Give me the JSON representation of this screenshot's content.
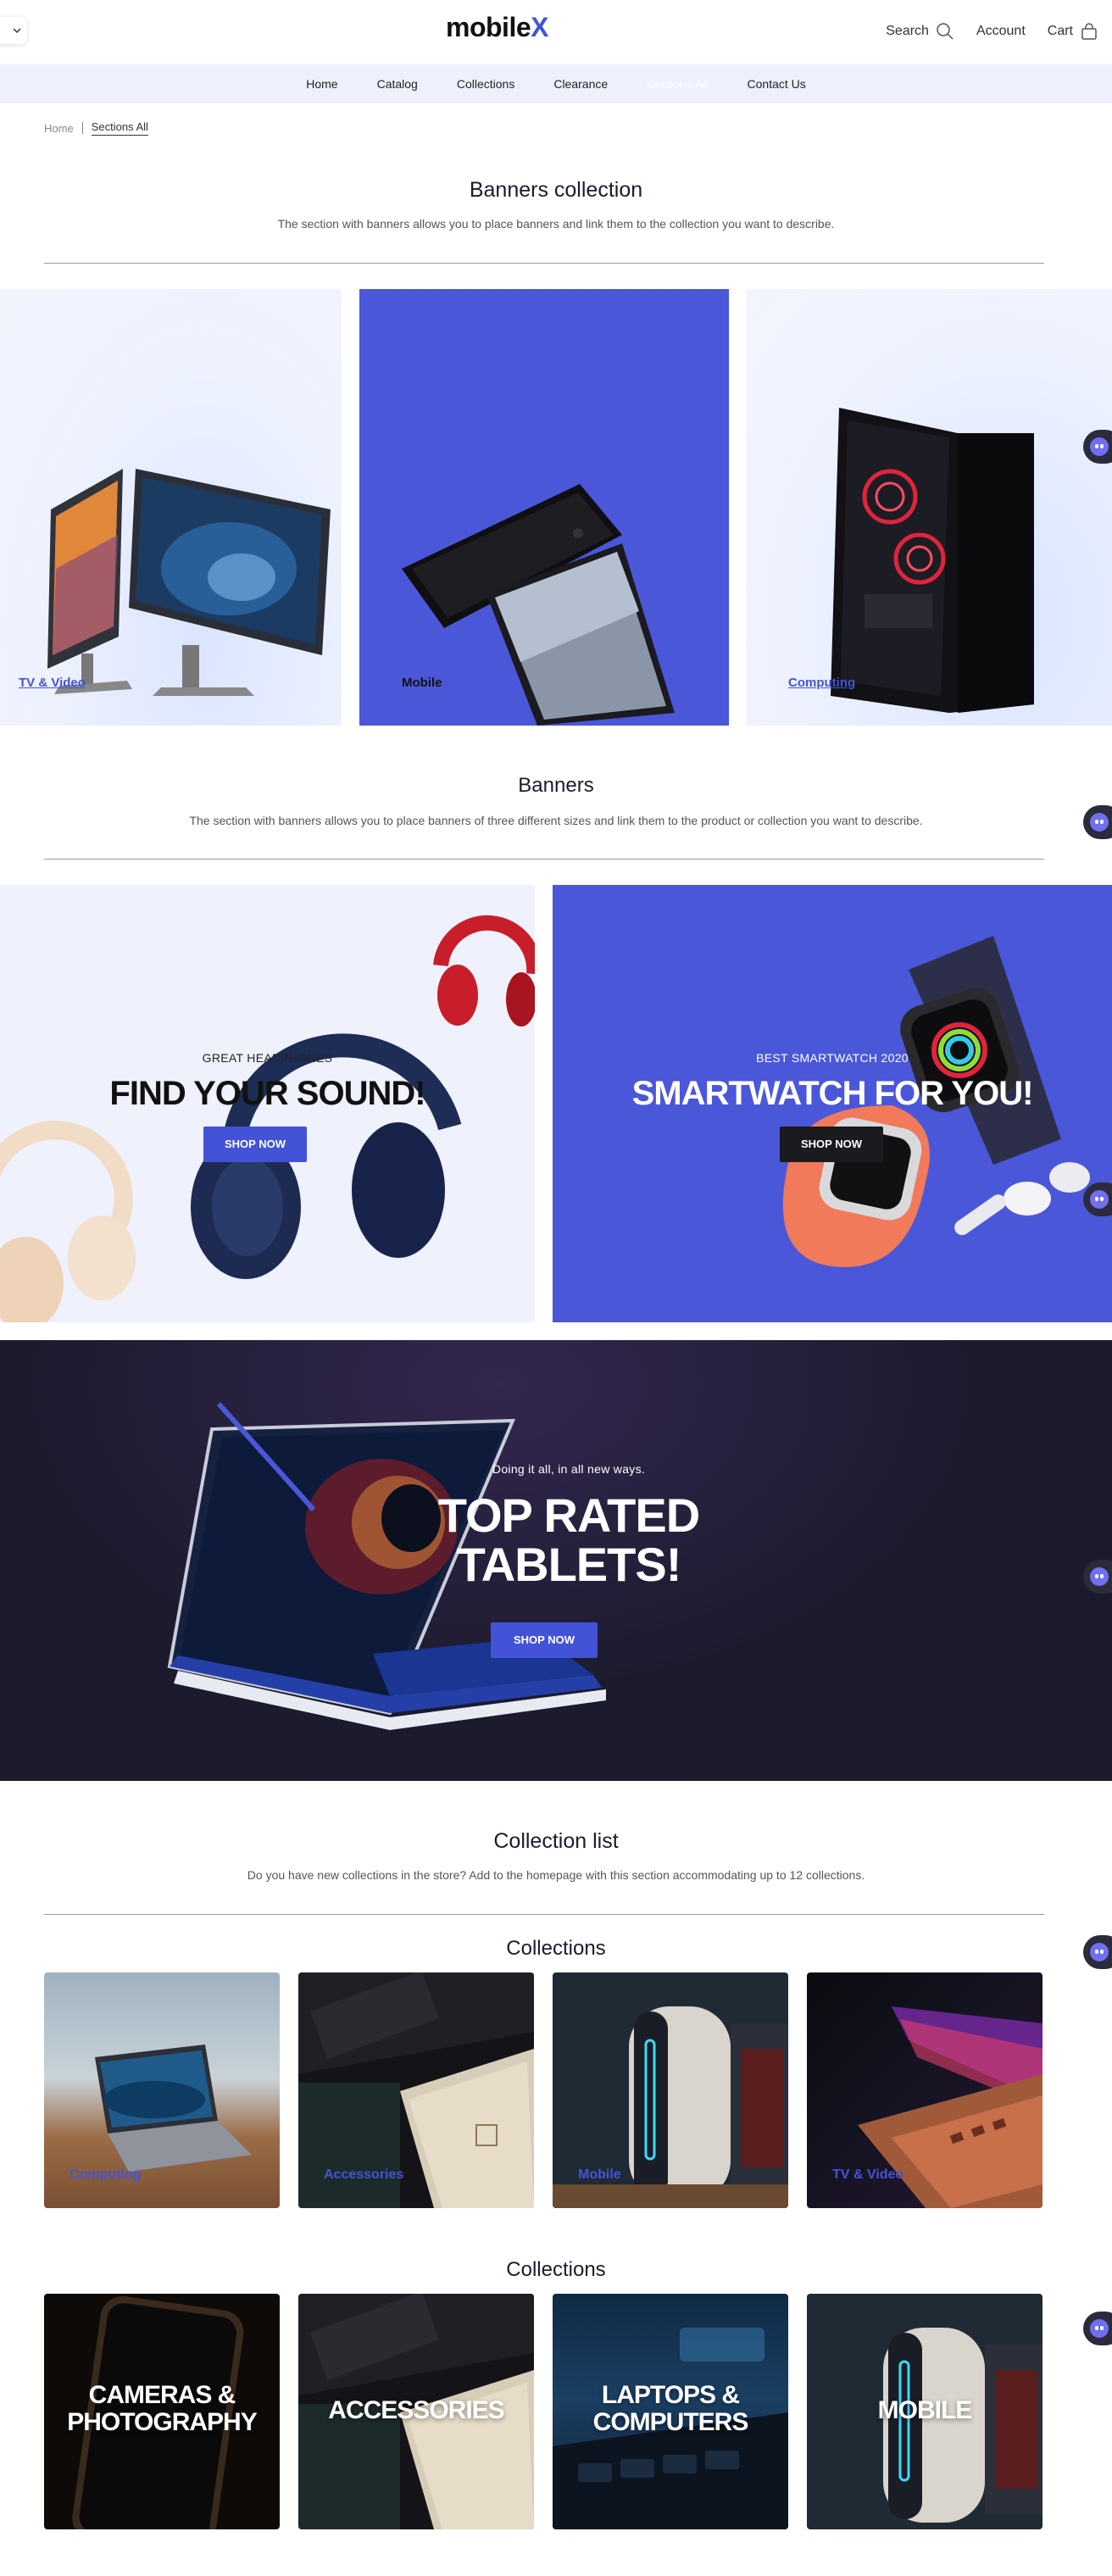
{
  "header": {
    "logo_main": "mobile",
    "logo_accent": "X",
    "search_label": "Search",
    "account_label": "Account",
    "cart_label": "Cart"
  },
  "nav": {
    "items": [
      "Home",
      "Catalog",
      "Collections",
      "Clearance",
      "Sections All",
      "Contact Us"
    ]
  },
  "breadcrumb": {
    "home": "Home",
    "current": "Sections All"
  },
  "banners_collection": {
    "title": "Banners collection",
    "description": "The section with banners allows you to place banners and link them to the collection you want to describe.",
    "items": [
      {
        "label": "TV & Video"
      },
      {
        "label": "Mobile"
      },
      {
        "label": "Computing"
      }
    ]
  },
  "banners": {
    "title": "Banners",
    "description": "The section with banners allows you to place banners of three different sizes and link them to the product or collection you want to describe.",
    "headphones": {
      "kicker": "GREAT HEADPHONES",
      "title": "FIND YOUR SOUND!",
      "button": "SHOP NOW"
    },
    "smartwatch": {
      "kicker": "BEST SMARTWATCH 2020",
      "title": "SMARTWATCH FOR YOU!",
      "button": "SHOP NOW"
    },
    "tablets": {
      "kicker": "Doing it all, in all new ways.",
      "title_line1": "TOP RATED",
      "title_line2": "TABLETS!",
      "button": "SHOP NOW"
    }
  },
  "collection_list": {
    "title": "Collection list",
    "description": "Do you have new collections in the store? Add to the homepage with this section accommodating up to 12 collections.",
    "group1": {
      "title": "Collections",
      "items": [
        {
          "label": "Computing"
        },
        {
          "label": "Accessories"
        },
        {
          "label": "Mobile"
        },
        {
          "label": "TV & Video"
        }
      ]
    },
    "group2": {
      "title": "Collections",
      "items": [
        {
          "line1": "CAMERAS &",
          "line2": "PHOTOGRAPHY"
        },
        {
          "line1": "ACCESSORIES",
          "line2": ""
        },
        {
          "line1": "LAPTOPS &",
          "line2": "COMPUTERS"
        },
        {
          "line1": "MOBILE",
          "line2": ""
        }
      ]
    }
  },
  "colors": {
    "accent": "#4353d8",
    "nav_bg": "#eef1fd",
    "dark_banner": "#1c1b2e"
  }
}
